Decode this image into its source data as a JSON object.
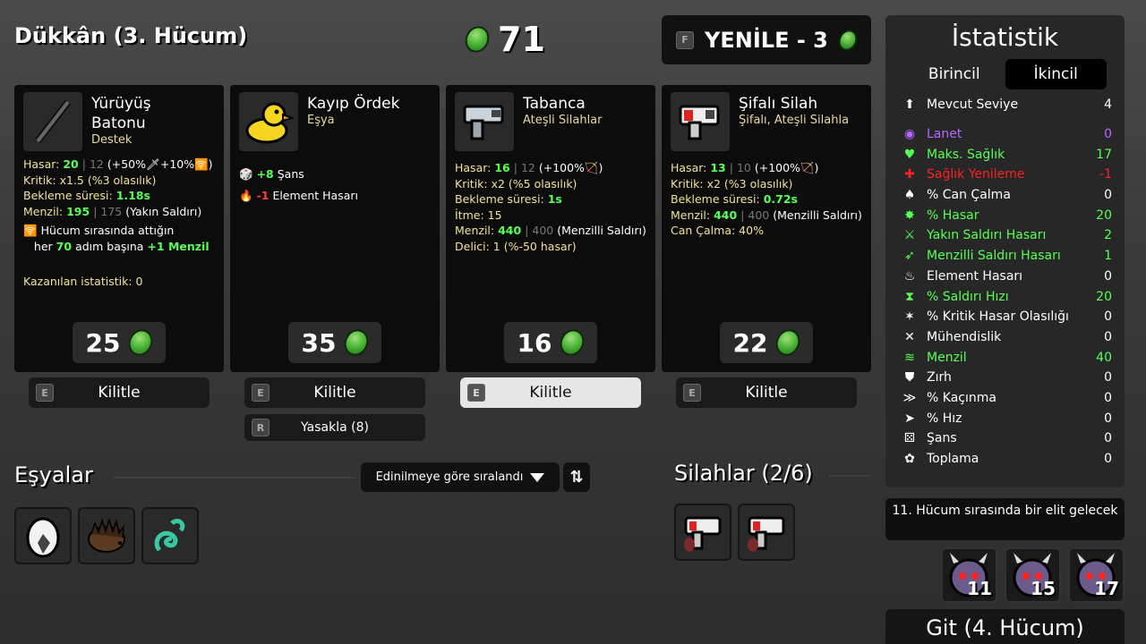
{
  "header": {
    "title": "Dükkân (3. Hücum)",
    "gold": "71",
    "reroll_key": "F",
    "reroll_label": "YENİLE - 3"
  },
  "cards": [
    {
      "name_line1": "Yürüyüş",
      "name_line2": "Batonu",
      "type": "Destek",
      "icon": "baton-icon",
      "stats": {
        "hasar_label": "Hasar:",
        "hasar_val": "20",
        "hasar_sep": "|",
        "hasar_base": "12",
        "hasar_extra": "(+50%🗡+10%🛜)",
        "kritik": "Kritik: x1.5 (%3 olasılık)",
        "bekleme_label": "Bekleme süresi:",
        "bekleme_val": "1.18s",
        "menzil_label": "Menzil:",
        "menzil_val": "195",
        "menzil_base": "175",
        "menzil_extra": "(Yakın Saldırı)",
        "effect_line1": "Hücum sırasında attığın",
        "effect_pre": "her",
        "effect_num": "70",
        "effect_mid": "adım başına",
        "effect_bonus": "+1 Menzil",
        "kazanilan": "Kazanılan istatistik: 0"
      },
      "price": "25",
      "lock_key": "E",
      "lock_label": "Kilitle"
    },
    {
      "name": "Kayıp Ördek",
      "type": "Eşya",
      "icon": "duck-icon",
      "stats": {
        "luck_val": "+8",
        "luck_label": "Şans",
        "elem_val": "-1",
        "elem_label": "Element Hasarı"
      },
      "price": "35",
      "lock_key": "E",
      "lock_label": "Kilitle",
      "ban_key": "R",
      "ban_label": "Yasakla (8)"
    },
    {
      "name": "Tabanca",
      "type": "Ateşli Silahlar",
      "icon": "pistol-icon",
      "stats": {
        "hasar_label": "Hasar:",
        "hasar_val": "16",
        "hasar_base": "12",
        "hasar_extra": "(+100%🏹)",
        "kritik": "Kritik: x2 (%5 olasılık)",
        "bekleme_label": "Bekleme süresi:",
        "bekleme_val": "1s",
        "itme": "İtme: 15",
        "menzil_label": "Menzil:",
        "menzil_val": "440",
        "menzil_base": "400",
        "menzil_extra": "(Menzilli Saldırı)",
        "delici": "Delici: 1 (%-50 hasar)"
      },
      "price": "16",
      "lock_key": "E",
      "lock_label": "Kilitle"
    },
    {
      "name": "Şifalı Silah",
      "type": "Şifalı, Ateşli Silahla",
      "icon": "medical-gun-icon",
      "stats": {
        "hasar_label": "Hasar:",
        "hasar_val": "13",
        "hasar_base": "10",
        "hasar_extra": "(+100%🏹)",
        "kritik": "Kritik: x2 (%3 olasılık)",
        "bekleme_label": "Bekleme süresi:",
        "bekleme_val": "0.72s",
        "menzil_label": "Menzil:",
        "menzil_val": "440",
        "menzil_base": "400",
        "menzil_extra": "(Menzilli Saldırı)",
        "can_calma": "Can Çalma: 40%"
      },
      "price": "22",
      "lock_key": "E",
      "lock_label": "Kilitle"
    }
  ],
  "items_section": {
    "title": "Eşyalar",
    "sort_label": "Edinilmeye göre sıralandı",
    "items": [
      "egg-icon",
      "hedgehog-icon",
      "tentacle-icon"
    ]
  },
  "weapons_section": {
    "title": "Silahlar (2/6)",
    "items": [
      "medical-gun-icon",
      "medical-gun-icon"
    ]
  },
  "stats_panel": {
    "title": "İstatistik",
    "tab_primary": "Birincil",
    "tab_secondary": "İkincil",
    "rows": [
      {
        "icon": "level-icon",
        "label": "Mevcut Seviye",
        "value": "4",
        "color": "white"
      },
      {
        "icon": "curse-icon",
        "label": "Lanet",
        "value": "0",
        "color": "purple"
      },
      {
        "icon": "heart-icon",
        "label": "Maks. Sağlık",
        "value": "17",
        "color": "green"
      },
      {
        "icon": "regen-icon",
        "label": "Sağlık Yenileme",
        "value": "-1",
        "color": "red"
      },
      {
        "icon": "lifesteal-icon",
        "label": "% Can Çalma",
        "value": "0",
        "color": "white"
      },
      {
        "icon": "damage-icon",
        "label": "% Hasar",
        "value": "20",
        "color": "green"
      },
      {
        "icon": "melee-icon",
        "label": "Yakın Saldırı Hasarı",
        "value": "2",
        "color": "green"
      },
      {
        "icon": "ranged-icon",
        "label": "Menzilli Saldırı Hasarı",
        "value": "1",
        "color": "green"
      },
      {
        "icon": "element-icon",
        "label": "Element Hasarı",
        "value": "0",
        "color": "white"
      },
      {
        "icon": "attack-speed-icon",
        "label": "% Saldırı Hızı",
        "value": "20",
        "color": "green"
      },
      {
        "icon": "crit-icon",
        "label": "% Kritik Hasar Olasılığı",
        "value": "0",
        "color": "white"
      },
      {
        "icon": "engineering-icon",
        "label": "Mühendislik",
        "value": "0",
        "color": "white"
      },
      {
        "icon": "range-icon",
        "label": "Menzil",
        "value": "40",
        "color": "green"
      },
      {
        "icon": "armor-icon",
        "label": "Zırh",
        "value": "0",
        "color": "white"
      },
      {
        "icon": "dodge-icon",
        "label": "% Kaçınma",
        "value": "0",
        "color": "white"
      },
      {
        "icon": "speed-icon",
        "label": "% Hız",
        "value": "0",
        "color": "white"
      },
      {
        "icon": "luck-icon",
        "label": "Şans",
        "value": "0",
        "color": "white"
      },
      {
        "icon": "harvest-icon",
        "label": "Toplama",
        "value": "0",
        "color": "white"
      }
    ]
  },
  "elite_notice": "11. Hücum sırasında bir elit gelecek",
  "enemies": [
    "11",
    "15",
    "17"
  ],
  "go_button": "Git (4. Hücum)",
  "colors": {
    "green": "#56ff56",
    "purple": "#b866ff",
    "red": "#ff2020",
    "yellow": "#f2e29a"
  }
}
